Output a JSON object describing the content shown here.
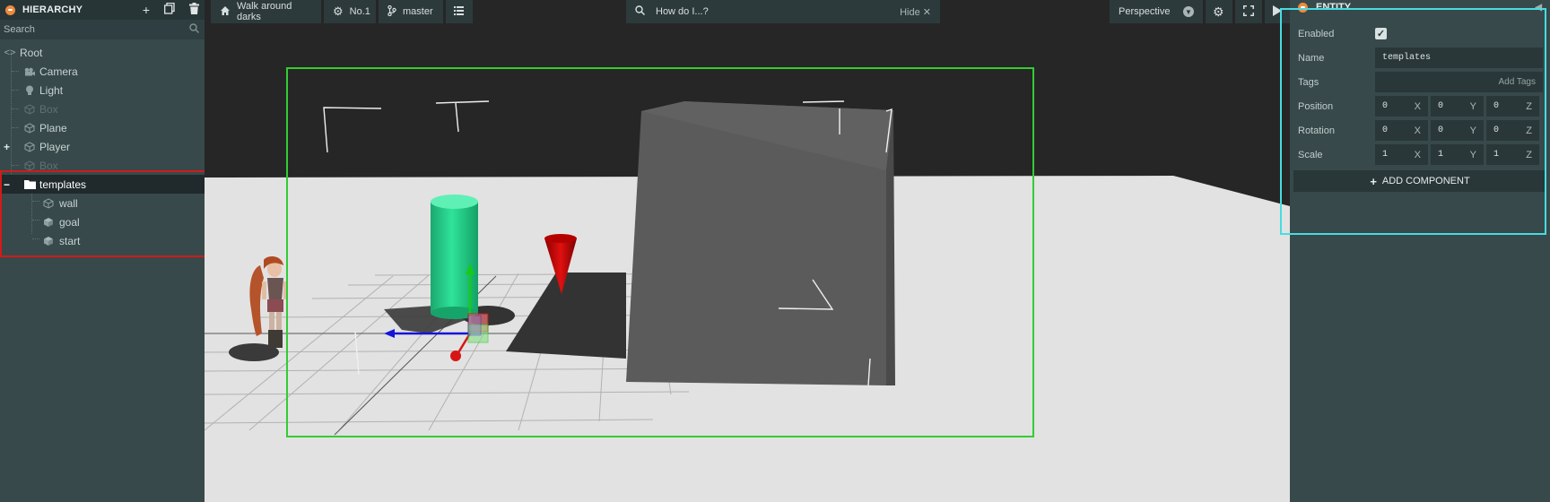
{
  "hierarchy": {
    "title": "HIERARCHY",
    "search_placeholder": "Search",
    "tools": {
      "add": "+",
      "duplicate": "⧉",
      "delete": "🗑"
    },
    "nodes": [
      {
        "label": "Root"
      },
      {
        "label": "Camera"
      },
      {
        "label": "Light"
      },
      {
        "label": "Box"
      },
      {
        "label": "Plane"
      },
      {
        "label": "Player"
      },
      {
        "label": "Box"
      },
      {
        "label": "templates"
      },
      {
        "label": "wall"
      },
      {
        "label": "goal"
      },
      {
        "label": "start"
      }
    ],
    "selected": "templates"
  },
  "toolbar": {
    "project": "Walk around darks",
    "scene": "No.1",
    "branch": "master",
    "help_search": "How do I...?",
    "hide": "Hide",
    "camera": "Perspective"
  },
  "entity": {
    "title": "ENTITY",
    "enabled_label": "Enabled",
    "enabled": true,
    "name_label": "Name",
    "name_value": "templates",
    "tags_label": "Tags",
    "tags_placeholder": "Add Tags",
    "position_label": "Position",
    "position": [
      "0",
      "0",
      "0"
    ],
    "rotation_label": "Rotation",
    "rotation": [
      "0",
      "0",
      "0"
    ],
    "scale_label": "Scale",
    "scale": [
      "1",
      "1",
      "1"
    ],
    "axes": [
      "X",
      "Y",
      "Z"
    ],
    "add_component": "ADD COMPONENT"
  },
  "colors": {
    "panel": "#37494b",
    "accent_orange": "#f08a3e",
    "highlight_red": "#d21a1a",
    "highlight_cyan": "#46dde0",
    "selection_green": "#33cc33"
  }
}
